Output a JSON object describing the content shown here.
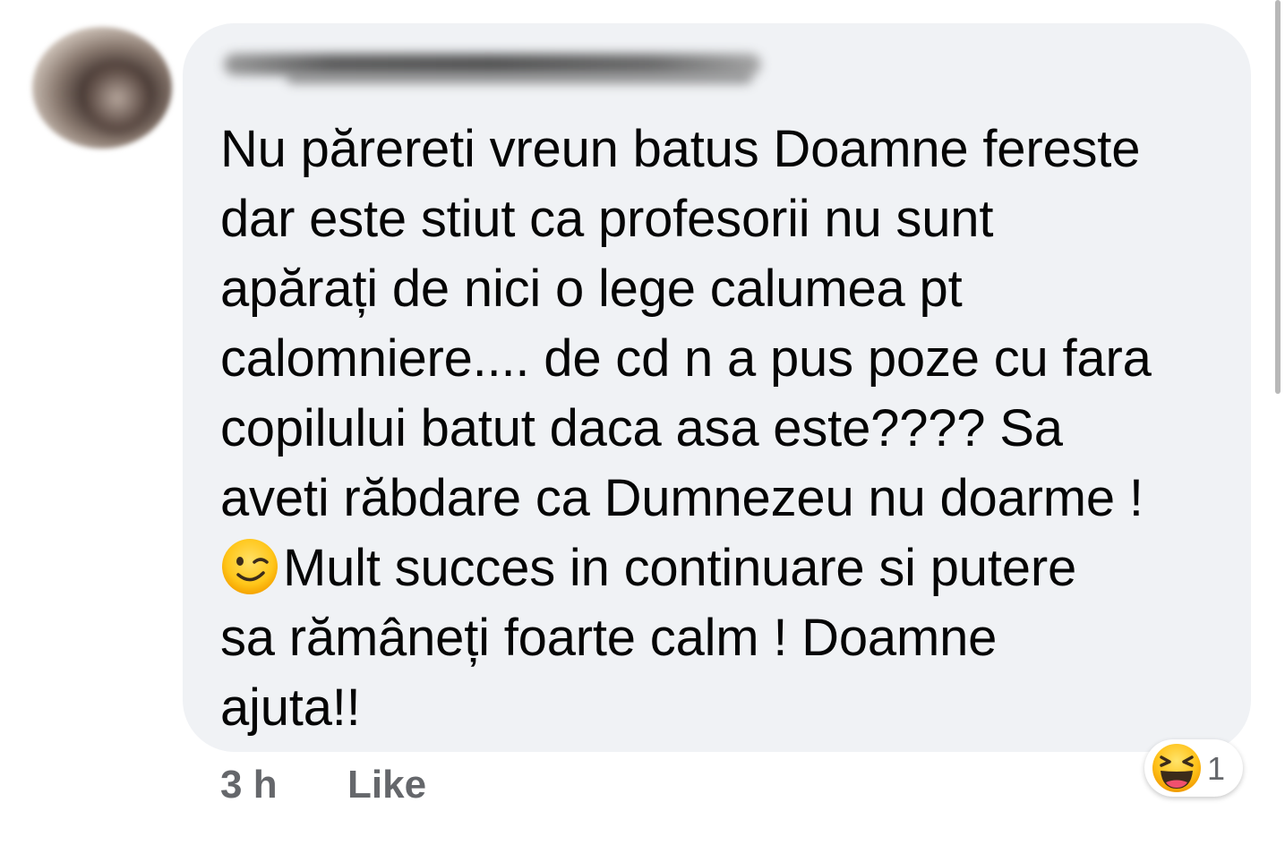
{
  "comment": {
    "lines": [
      "Nu părereti vreun batus Doamne fereste",
      "dar este stiut ca profesorii nu sunt",
      "apărați de nici o lege calumea pt",
      "calomniere.... de cd n a pus poze cu fara",
      "copilului batut daca asa este???? Sa",
      "aveti răbdare ca Dumnezeu nu doarme !",
      "Mult succes in continuare si putere",
      "sa rămâneți foarte calm ! Doamne",
      "ajuta!!"
    ]
  },
  "meta": {
    "time": "3 h",
    "like_label": "Like"
  },
  "reaction": {
    "icon": "haha-emoji-icon",
    "count": "1"
  },
  "colors": {
    "bubble_bg": "#f0f2f5",
    "text": "#050505",
    "meta": "#65676b"
  }
}
